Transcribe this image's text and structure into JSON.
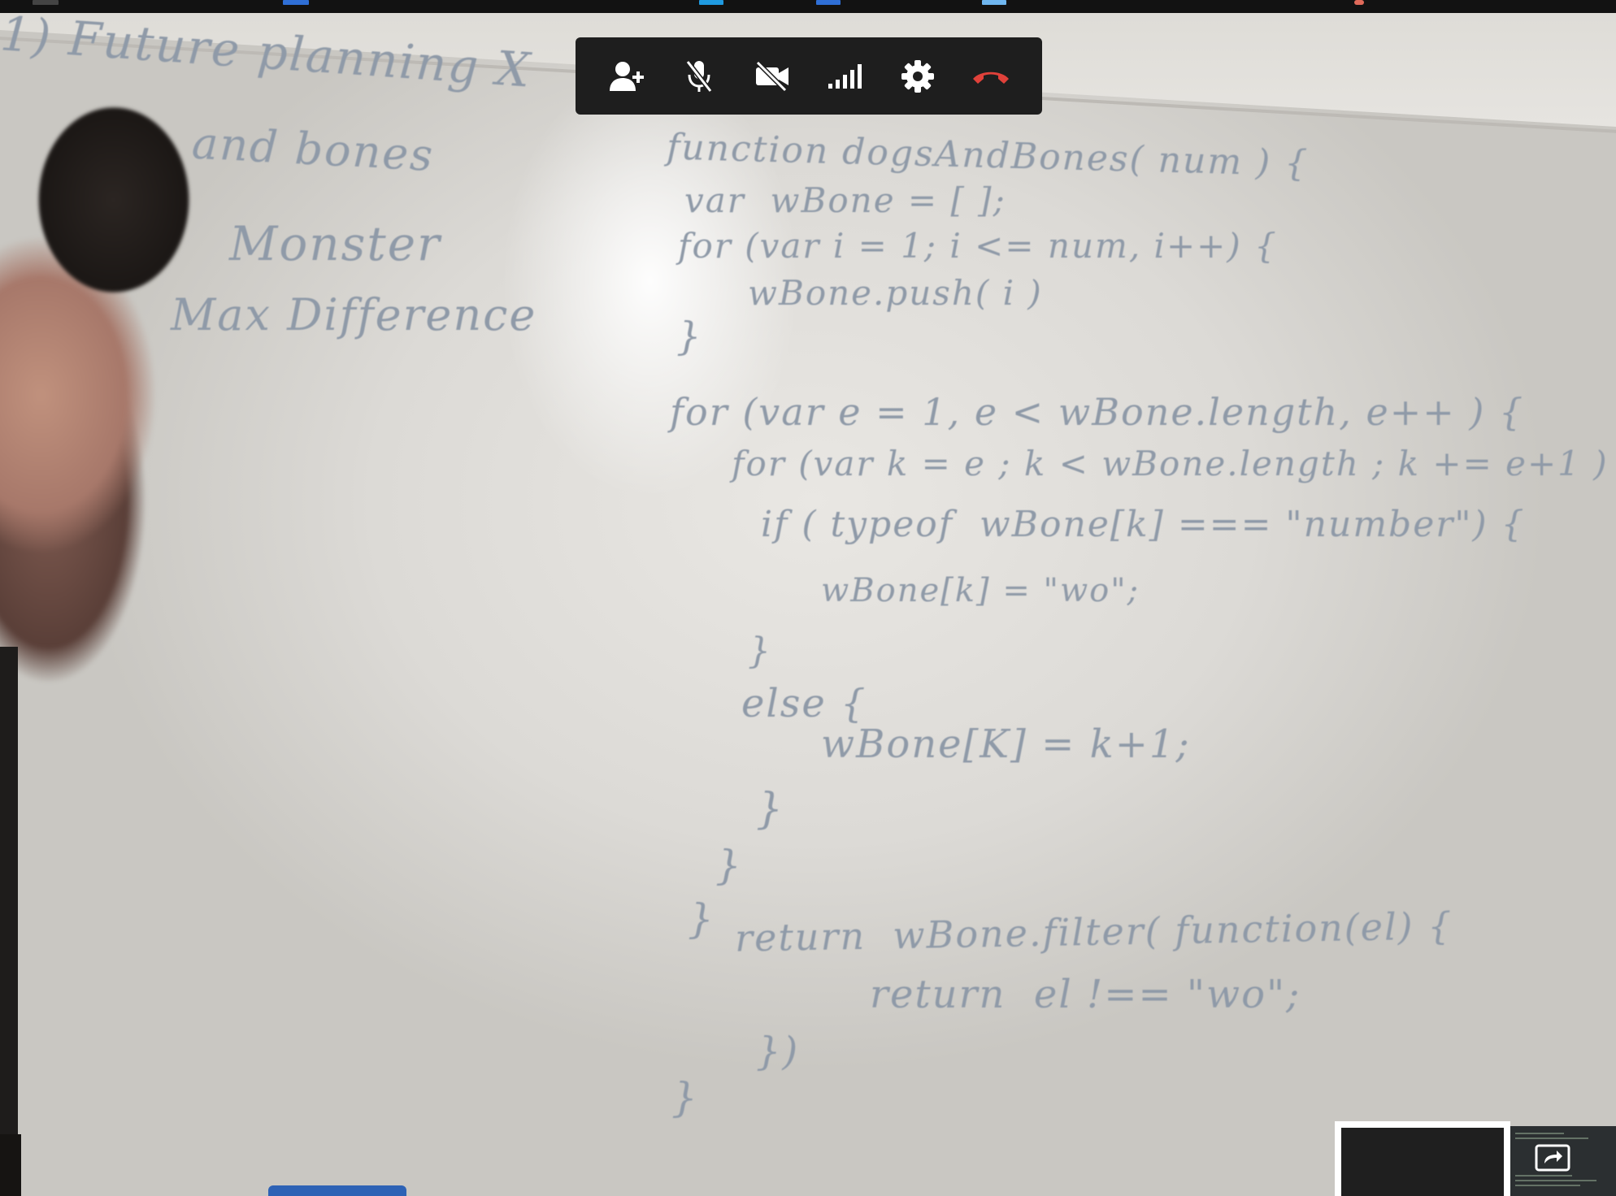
{
  "board": {
    "left_lines": [
      "1) Future planning X",
      "and bones",
      "Monster",
      "Max Difference"
    ],
    "code_lines": [
      "function dogsAndBones( num ) {",
      "var  wBone = [ ];",
      "for (var i = 1; i <= num, i++) {",
      "wBone.push( i )",
      "}",
      "for (var e = 1, e < wBone.length, e++ ) {",
      "for (var k = e ; k < wBone.length ; k += e+1 )",
      "if ( typeof  wBone[k] === \"number\") {",
      "wBone[k] = \"wo\";",
      "}",
      "else {",
      "wBone[K] = k+1;",
      "}",
      "}",
      "}",
      "return  wBone.filter( function(el) {",
      "return  el !== \"wo\";",
      "})",
      "}"
    ]
  },
  "toolbar": {
    "buttons": [
      {
        "icon": "add-person-icon"
      },
      {
        "icon": "mic-off-icon"
      },
      {
        "icon": "camera-off-icon"
      },
      {
        "icon": "signal-bars-icon"
      },
      {
        "icon": "settings-gear-icon"
      },
      {
        "icon": "hang-up-icon",
        "color": "#e0413a"
      }
    ]
  },
  "colors": {
    "toolbar_bg": "#1e1e1e",
    "icon": "#ffffff",
    "hangup": "#e0413a",
    "marker": "#8f9aa8"
  }
}
